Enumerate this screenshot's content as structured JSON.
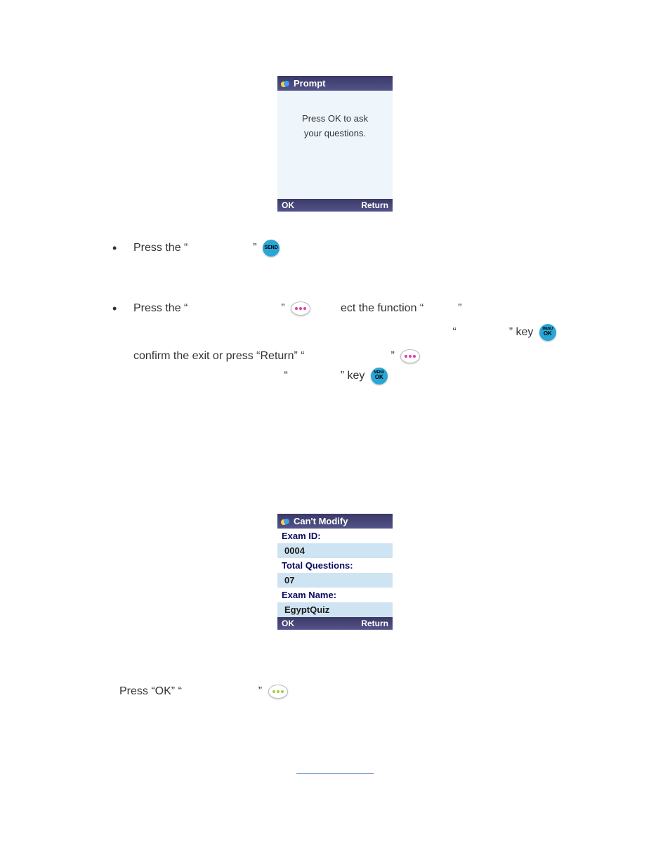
{
  "device1": {
    "title": "Prompt",
    "body_line1": "Press OK to ask",
    "body_line2": "your questions.",
    "left": "OK",
    "right": "Return"
  },
  "instr1": {
    "seg_a": "Press the “",
    "seg_b": "”"
  },
  "instr2": {
    "seg_a": "Press the “",
    "seg_b": "”",
    "seg_c": "ect the function “",
    "seg_d": "”"
  },
  "instr3": {
    "seg_a": "“",
    "seg_b": "” key"
  },
  "instr4": {
    "seg_a": "confirm the exit or press “Return” “",
    "seg_b": "”"
  },
  "instr5": {
    "seg_a": "“",
    "seg_b": "” key"
  },
  "device2": {
    "title": "Can't  Modify",
    "examid_label": "Exam ID:",
    "examid_value": "0004",
    "total_label": "Total Questions:",
    "total_value": "07",
    "name_label": "Exam Name:",
    "name_value": "EgyptQuiz",
    "left": "OK",
    "right": "Return"
  },
  "ok_line": {
    "seg_a": "Press “OK” “",
    "seg_b": "”"
  },
  "keys": {
    "send": "SEND",
    "menu": "MENU",
    "ok": "OK"
  }
}
